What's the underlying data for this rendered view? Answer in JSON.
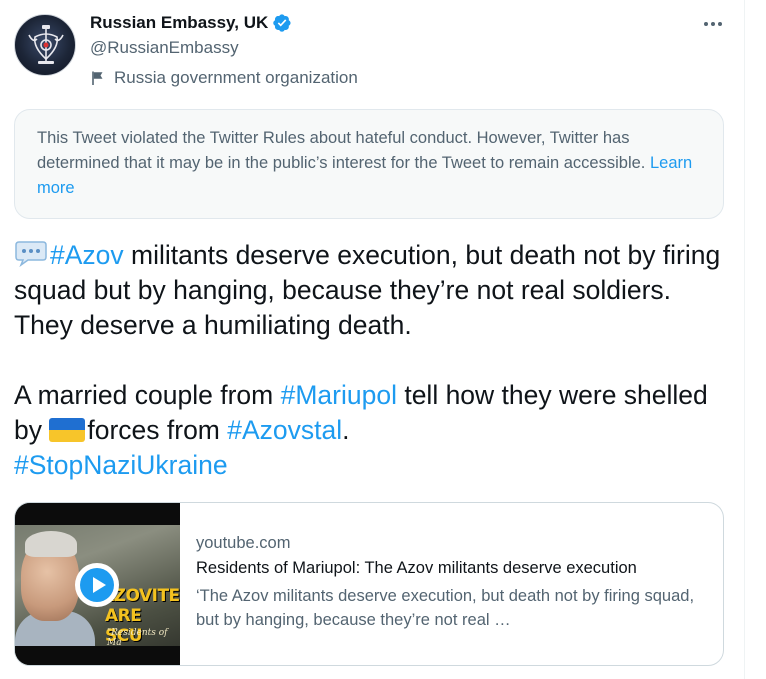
{
  "author": {
    "name": "Russian Embassy, UK",
    "handle": "@RussianEmbassy",
    "label": "Russia government organization",
    "verified_icon": "verified-badge-icon",
    "label_icon": "flag-icon"
  },
  "notice": {
    "text": "This Tweet violated the Twitter Rules about hateful conduct. However, Twitter has determined that it may be in the public’s interest for the Tweet to remain accessible.",
    "link": "Learn more"
  },
  "tweet": {
    "line1_tag": "#Azov",
    "line1_rest": " militants deserve execution, but death not by firing squad but by hanging, because they’re not real soldiers. They deserve a humiliating death.",
    "para2_a": "A married couple from ",
    "tag_mariupol": "#Mariupol",
    "para2_b": " tell how they were shelled by ",
    "para2_c": "forces from ",
    "tag_azovstal": "#Azovstal",
    "para2_d": ".",
    "tag_stop": "#StopNaziUkraine"
  },
  "card": {
    "domain": "youtube.com",
    "title": "Residents of Mariupol: The Azov militants deserve execution",
    "description": "‘The Azov militants deserve execution, but death not by firing squad, but by hanging, because they’re not real …",
    "thumb_caption1": "AZOVITE",
    "thumb_caption2": "ARE SCU",
    "thumb_caption3": "\"Residents of Ma"
  },
  "colors": {
    "link": "#1d9bf0",
    "secondary_text": "#536471",
    "primary_text": "#0f1419",
    "notice_bg": "#f7f9f9",
    "ukraine_blue": "#1f6fd1",
    "ukraine_yellow": "#f7c52a"
  }
}
